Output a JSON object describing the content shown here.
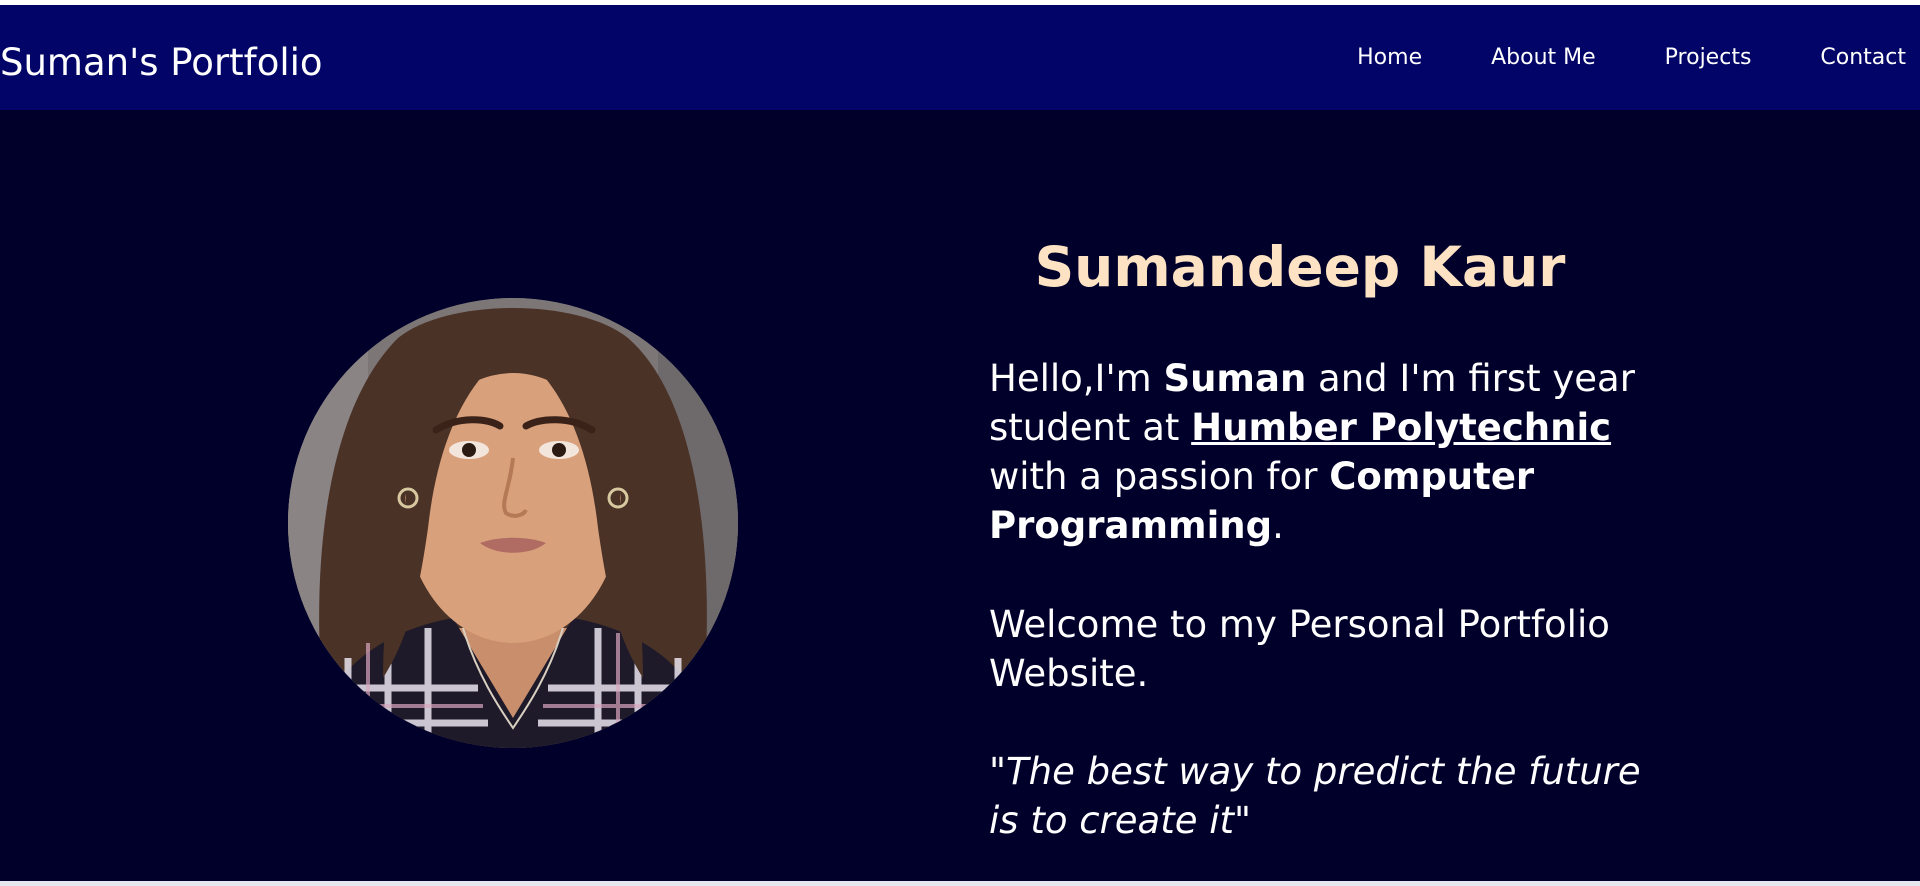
{
  "navbar": {
    "brand": "Suman's Portfolio",
    "links": [
      "Home",
      "About Me",
      "Projects",
      "Contact"
    ]
  },
  "hero": {
    "name": "Sumandeep Kaur",
    "bio": {
      "part1": "Hello,I'm ",
      "nickname": "Suman",
      "part2": " and I'm first year student at ",
      "school": "Humber Polytechnic",
      "part3": " with a passion for ",
      "field": "Computer Programming",
      "part4": "."
    },
    "welcome": "Welcome to my Personal Portfolio Website.",
    "quote": {
      "open": "\"",
      "text": "The best way to predict the future is to create it",
      "close": "\""
    }
  },
  "colors": {
    "navbar_bg": "#020567",
    "hero_bg": "#01002a",
    "name_color": "#fde3c4",
    "text_color": "#ffffff"
  }
}
